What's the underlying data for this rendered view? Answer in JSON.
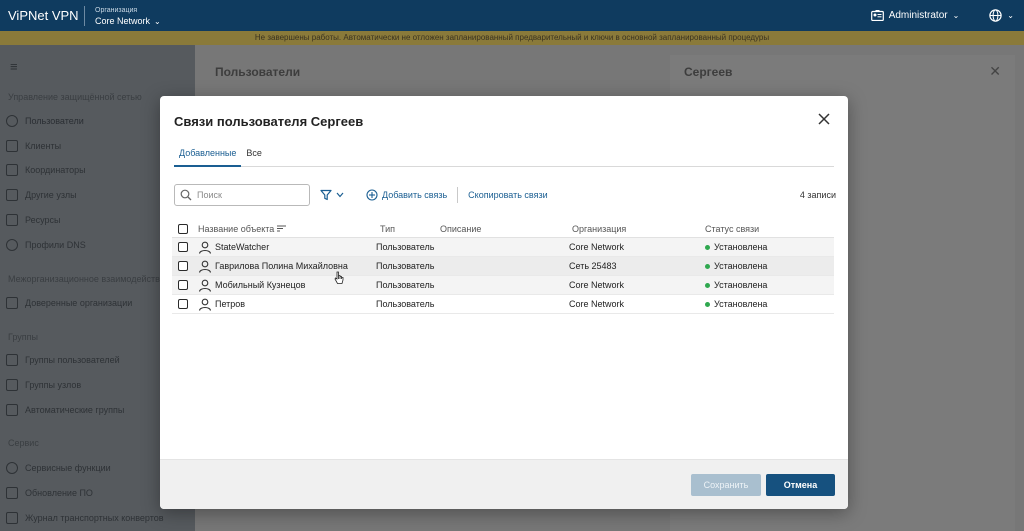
{
  "app": {
    "title": "ViPNet VPN",
    "org_caption": "Организация",
    "org_name": "Core Network",
    "user": "Administrator"
  },
  "banner": {
    "text": "Не завершены работы. Автоматически не отложен запланированный предварительный и ключи в основной запланированный процедуры"
  },
  "sidebar": {
    "sections": [
      {
        "label": "Управление защищённой сетью"
      },
      {
        "label": "Межорганизационное взаимодействие"
      },
      {
        "label": "Группы"
      },
      {
        "label": "Сервис"
      }
    ],
    "items": [
      {
        "label": "Пользователи"
      },
      {
        "label": "Клиенты"
      },
      {
        "label": "Координаторы"
      },
      {
        "label": "Другие узлы"
      },
      {
        "label": "Ресурсы"
      },
      {
        "label": "Профили DNS"
      },
      {
        "label": "Доверенные организации"
      },
      {
        "label": "Группы пользователей"
      },
      {
        "label": "Группы узлов"
      },
      {
        "label": "Автоматические группы"
      },
      {
        "label": "Сервисные функции"
      },
      {
        "label": "Обновление ПО"
      },
      {
        "label": "Журнал транспортных конвертов"
      }
    ]
  },
  "page": {
    "title": "Пользователи",
    "detail_title": "Сергеев"
  },
  "modal": {
    "title": "Связи пользователя Сергеев",
    "tabs": [
      {
        "label": "Добавленные",
        "active": true
      },
      {
        "label": "Все",
        "active": false
      }
    ],
    "search_placeholder": "Поиск",
    "add_link": "Добавить связь",
    "copy_link": "Скопировать связи",
    "count": "4 записи",
    "columns": {
      "name": "Название объекта",
      "type": "Тип",
      "description": "Описание",
      "organization": "Организация",
      "status": "Статус связи"
    },
    "rows": [
      {
        "name": "StateWatcher",
        "type": "Пользователь",
        "description": "",
        "organization": "Core Network",
        "status": "Установлена"
      },
      {
        "name": "Гаврилова Полина Михайловна",
        "type": "Пользователь",
        "description": "",
        "organization": "Сеть 25483",
        "status": "Установлена"
      },
      {
        "name": "Мобильный Кузнецов",
        "type": "Пользователь",
        "description": "",
        "organization": "Core Network",
        "status": "Установлена"
      },
      {
        "name": "Петров",
        "type": "Пользователь",
        "description": "",
        "organization": "Core Network",
        "status": "Установлена"
      }
    ],
    "save_label": "Сохранить",
    "cancel_label": "Отмена"
  },
  "colors": {
    "topbar": "#0f3b5f",
    "accent": "#1a5e92",
    "status_ok": "#2fa84f",
    "cancel_button": "#16517f",
    "save_button_disabled": "#a9bfcf"
  },
  "icons": [
    "menu-icon",
    "user-icon",
    "filter-icon",
    "add-circle-icon",
    "search-icon",
    "close-icon",
    "globe-icon",
    "id-card-icon",
    "sort-icon",
    "chevron-down-icon"
  ]
}
